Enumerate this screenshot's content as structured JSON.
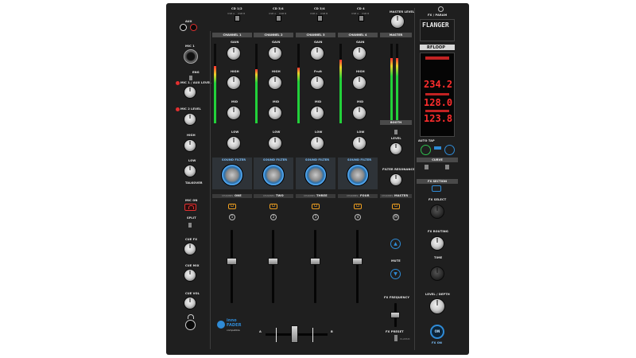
{
  "input_selectors": [
    {
      "label": "CD 1/2",
      "options": [
        "USB A",
        "USB B"
      ]
    },
    {
      "label": "CD 3/4",
      "options": [
        "USB A",
        "USB B"
      ]
    },
    {
      "label": "CD 3/4",
      "options": [
        "USB A",
        "USB B"
      ]
    },
    {
      "label": "CD 4",
      "options": [
        "USB A",
        "USB B"
      ]
    }
  ],
  "master_level_label": "MASTER LEVEL",
  "left_panel": {
    "aux": "AUX",
    "mic1": "MIC 1",
    "eng": "ENG",
    "mic1_aux_level": "MIC 1 / AUX LEVEL",
    "mic2_level": "MIC 2 LEVEL",
    "high": "HIGH",
    "low": "LOW",
    "talkover": "TALKOVER",
    "mic_on": "MIC ON",
    "split": "SPLIT",
    "cue_fx": "CUE FX",
    "cue_mix": "CUE MIX",
    "cue_vol": "CUE VOL"
  },
  "channels": [
    {
      "header": "CHANNEL 1",
      "gain": "GAIN",
      "high": "HIGH",
      "mid": "MID",
      "low": "LOW",
      "sound_filter": "SOUND FILTER",
      "name": "ONE",
      "cue_num": "1",
      "meter_level": 0.72
    },
    {
      "header": "CHANNEL 2",
      "gain": "GAIN",
      "high": "HIGH",
      "mid": "MID",
      "low": "LOW",
      "sound_filter": "SOUND FILTER",
      "name": "TWO",
      "cue_num": "2",
      "meter_level": 0.68
    },
    {
      "header": "CHANNEL 3",
      "gain": "GAIN",
      "high": "Fruit",
      "mid": "MID",
      "low": "LOW",
      "sound_filter": "SOUND FILTER",
      "name": "THREE",
      "cue_num": "3",
      "meter_level": 0.7
    },
    {
      "header": "CHANNEL 4",
      "gain": "GAIN",
      "high": "HIGH",
      "mid": "MID",
      "low": "LOW",
      "sound_filter": "SOUND FILTER",
      "name": "FOUR",
      "cue_num": "4",
      "meter_level": 0.8
    }
  ],
  "channel_name_prefix": "CHANNEL",
  "master": {
    "header": "MASTER",
    "gain": "GAIN",
    "booth": "BOOTH",
    "level": "LEVEL",
    "filter_resonance": "FILTER RESONANCE",
    "name": "MASTER",
    "cue_num": "M",
    "meter_level": 0.82,
    "mute": "MUTE",
    "fx_frequency": "FX FREQUENCY",
    "fx_preset": "FX PRESET",
    "classic": "CLASSIC"
  },
  "fx_panel": {
    "title": "FX / PARAM",
    "effect_name": "FLANGER",
    "brand": "RFLOOP",
    "bpm": "234.2",
    "value1": "128.0",
    "value2": "123.8",
    "auto_tap": "AUTO TAP",
    "curve": "CURVE",
    "fx_section": "FX SECTION",
    "fx_select": "FX SELECT",
    "fx_routing": "FX ROUTING",
    "time": "TIME",
    "level_depth": "LEVEL / DEPTH",
    "on": "ON",
    "fx_on": "FX ON"
  },
  "crossfader": {
    "left": "A",
    "right": "B"
  },
  "innofader": {
    "line1": "inno",
    "line2": "FADER",
    "line3": "compatible"
  },
  "colors": {
    "accent_blue": "#2f8bd6",
    "accent_amber": "#f0a020",
    "accent_green": "#2fbf4f",
    "accent_red": "#e23030",
    "meter_green": "#22d13a",
    "display_red": "#ff2d2d"
  }
}
